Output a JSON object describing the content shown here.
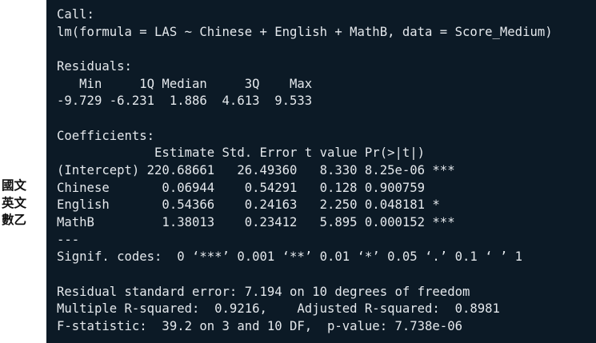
{
  "side_labels": [
    "國文",
    "英文",
    "數乙"
  ],
  "console": {
    "lines": [
      "Call:",
      "lm(formula = LAS ~ Chinese + English + MathB, data = Score_Medium)",
      "",
      "Residuals:",
      "   Min     1Q Median     3Q    Max",
      "-9.729 -6.231  1.886  4.613  9.533",
      "",
      "Coefficients:",
      "             Estimate Std. Error t value Pr(>|t|)",
      "(Intercept) 220.68661   26.49360   8.330 8.25e-06 ***",
      "Chinese       0.06944    0.54291   0.128 0.900759",
      "English       0.54366    0.24163   2.250 0.048181 *",
      "MathB         1.38013    0.23412   5.895 0.000152 ***",
      "---",
      "Signif. codes:  0 ‘***’ 0.001 ‘**’ 0.01 ‘*’ 0.05 ‘.’ 0.1 ‘ ’ 1",
      "",
      "Residual standard error: 7.194 on 10 degrees of freedom",
      "Multiple R-squared:  0.9216,    Adjusted R-squared:  0.8981",
      "F-statistic:  39.2 on 3 and 10 DF,  p-value: 7.738e-06"
    ]
  }
}
